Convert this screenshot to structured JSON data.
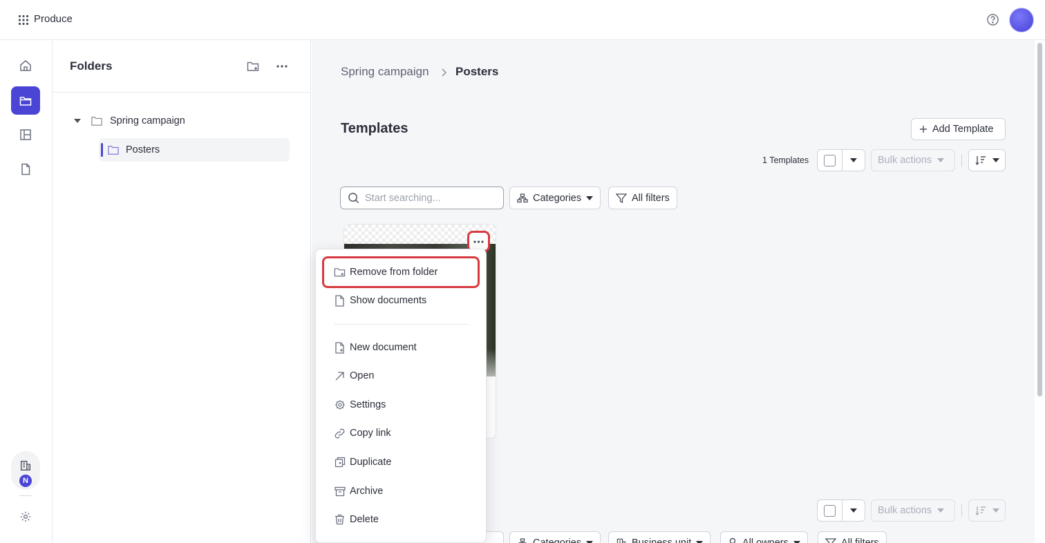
{
  "app": {
    "name": "Produce"
  },
  "folders_panel": {
    "title": "Folders",
    "tree": [
      {
        "label": "Spring campaign",
        "expanded": true,
        "children": [
          {
            "label": "Posters",
            "selected": true
          }
        ]
      }
    ]
  },
  "breadcrumb": {
    "parent": "Spring campaign",
    "current": "Posters"
  },
  "templates": {
    "title": "Templates",
    "add_label": "Add Template",
    "count_label": "1 Templates",
    "bulk_actions_label": "Bulk actions",
    "search_placeholder": "Start searching...",
    "filters": {
      "categories": "Categories",
      "all_filters": "All filters"
    }
  },
  "documents_toolbar": {
    "bulk_actions_label": "Bulk actions",
    "filters": {
      "categories": "Categories",
      "business_unit": "Business unit",
      "all_owners": "All owners",
      "all_filters": "All filters"
    }
  },
  "context_menu": {
    "items": [
      {
        "label": "Remove from folder",
        "icon": "folder-remove-icon",
        "highlighted": true
      },
      {
        "label": "Show documents",
        "icon": "document-icon"
      },
      {
        "label": "New document",
        "icon": "document-plus-icon"
      },
      {
        "label": "Open",
        "icon": "arrow-up-right-icon"
      },
      {
        "label": "Settings",
        "icon": "gear-icon"
      },
      {
        "label": "Copy link",
        "icon": "link-icon"
      },
      {
        "label": "Duplicate",
        "icon": "duplicate-icon"
      },
      {
        "label": "Archive",
        "icon": "archive-icon"
      },
      {
        "label": "Delete",
        "icon": "trash-icon"
      }
    ]
  },
  "rail": {
    "badge_letter": "N",
    "active_item": "folders"
  },
  "colors": {
    "accent": "#4b45d6",
    "highlight": "#d8393f",
    "background": "#f5f6f8"
  }
}
